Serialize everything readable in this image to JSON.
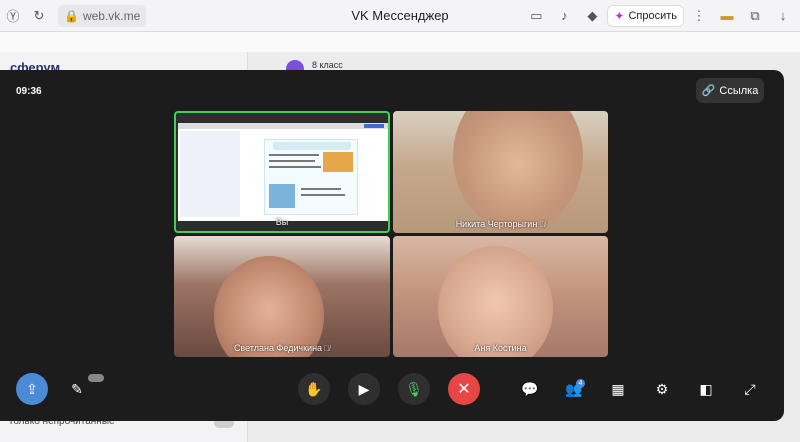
{
  "browser": {
    "url": "web.vk.me",
    "title": "VK Мессенджер",
    "ask_label": "Спросить"
  },
  "background": {
    "logo": "сферум",
    "chat_title": "8 класс",
    "unread_filter": "Только непрочитанные"
  },
  "call": {
    "time": "09:36",
    "link_label": "Ссылка",
    "participants": [
      {
        "name": "Вы",
        "muted": false
      },
      {
        "name": "Никита Черторыгин",
        "muted": true
      },
      {
        "name": "Светлана Федичкина",
        "muted": true
      },
      {
        "name": "Аня Костина",
        "muted": false
      }
    ],
    "controls": {
      "raise_hand": "raise-hand-icon",
      "camera": "camera-icon",
      "microphone": "microphone-icon",
      "end_call": "end-call-icon",
      "chat": "chat-icon",
      "participants_badge": "4",
      "layout": "grid-icon",
      "settings": "gear-icon"
    }
  },
  "colors": {
    "active_border": "#3cd25a",
    "end_call": "#e64646",
    "accent": "#4b8ad6",
    "mic_on": "#4bd264"
  }
}
